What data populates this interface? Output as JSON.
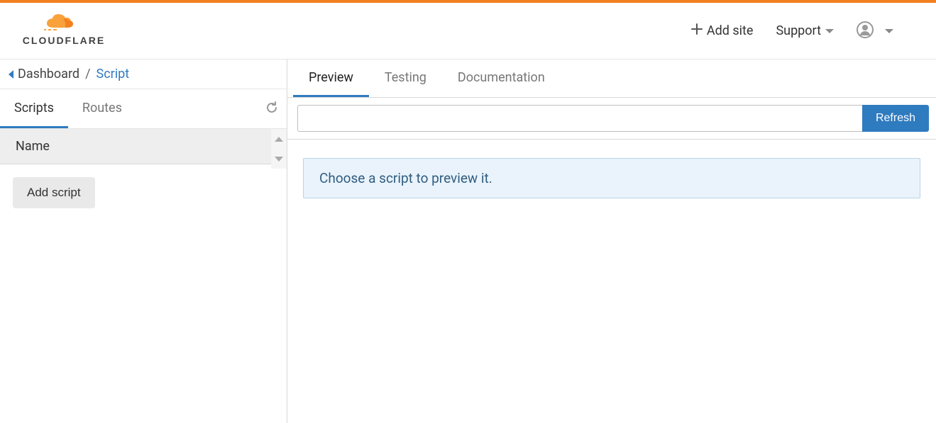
{
  "header": {
    "add_site_label": "Add site",
    "support_label": "Support"
  },
  "breadcrumb": {
    "dashboard": "Dashboard",
    "separator": "/",
    "script": "Script"
  },
  "sidebar": {
    "tabs": [
      {
        "label": "Scripts",
        "active": true
      },
      {
        "label": "Routes",
        "active": false
      }
    ],
    "table_header": "Name",
    "add_script_label": "Add script"
  },
  "content": {
    "tabs": [
      {
        "label": "Preview",
        "active": true
      },
      {
        "label": "Testing",
        "active": false
      },
      {
        "label": "Documentation",
        "active": false
      }
    ],
    "url_input_value": "",
    "refresh_label": "Refresh",
    "info_message": "Choose a script to preview it."
  },
  "colors": {
    "brand_orange": "#f38020",
    "link_blue": "#2f7bbf",
    "banner_bg": "#eaf3fb",
    "banner_border": "#b8d5ea"
  }
}
